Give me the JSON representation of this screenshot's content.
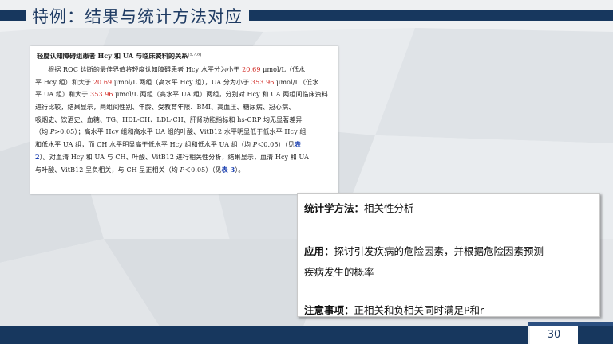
{
  "slide": {
    "title": "特例：结果与统计方法对应",
    "page_number": "30"
  },
  "document": {
    "heading": "轻度认知障碍组患者 Hcy 和 UA 与临床资料的关系",
    "heading_ref": "[5,7,8]",
    "l1": {
      "a": "根据 ROC 诊断的最佳界值将轻度认知障碍患者 Hcy 水平分为小于 ",
      "b": "20.69",
      "c": " μmol/L（低水"
    },
    "l2": {
      "a": "平 Hcy 组）和大于 ",
      "b": "20.69",
      "c": " μmol/L 两组（高水平 Hcy 组），UA 分为小于 ",
      "d": "353.96",
      "e": " μmol/L（低水"
    },
    "l3": {
      "a": "平 UA 组）和大于 ",
      "b": "353.96",
      "c": " μmol/L 两组（高水平 UA 组）两组，分别对 Hcy 和 UA 两组间临床资料"
    },
    "l4": "进行比较，结果显示，两组间性别、年龄、受教育年限、BMI、高血压、糖尿病、冠心病、",
    "l5": "吸烟史、饮酒史、血糖、TG、HDL-CH、LDL-CH、肝肾功能指标和 hs-CRP 均无显著差异",
    "l6": {
      "a": "（均 ",
      "p": "P",
      "b": ">0.05）；高水平 Hcy 组和高水平 UA 组的叶酸、VitB12 水平明显低于低水平 Hcy 组"
    },
    "l7": {
      "a": "和低水平 UA 组，而 CH 水平明显高于低水平 Hcy 组和低水平 UA 组（均 ",
      "p": "P",
      "b": "＜0.05）（见",
      "c": "表"
    },
    "l8": {
      "a": "2",
      "b": "）。对血清 Hcy 和 UA 与 CH、叶酸、VitB12 进行相关性分析，结果显示，血清 Hcy 和 UA"
    },
    "l9": {
      "a": "与叶酸、VitB12 呈负相关，与 CH 呈正相关（均 ",
      "p": "P",
      "b": "＜0.05）（见",
      "c": "表 3",
      "d": "）。"
    }
  },
  "note": {
    "row1_label": "统计学方法：",
    "row1_value": "相关性分析",
    "row2_label": "应用：",
    "row2_value": "探讨引发疾病的危险因素，并根据危险因素预测",
    "row3_value": "疾病发生的概率",
    "row4_label": "注意事项：",
    "row4_value": "正相关和负相关同时满足P和r"
  },
  "colors": {
    "navy": "#17375e",
    "highlight_red": "#d0251f",
    "link_blue": "#1a3fb0"
  }
}
